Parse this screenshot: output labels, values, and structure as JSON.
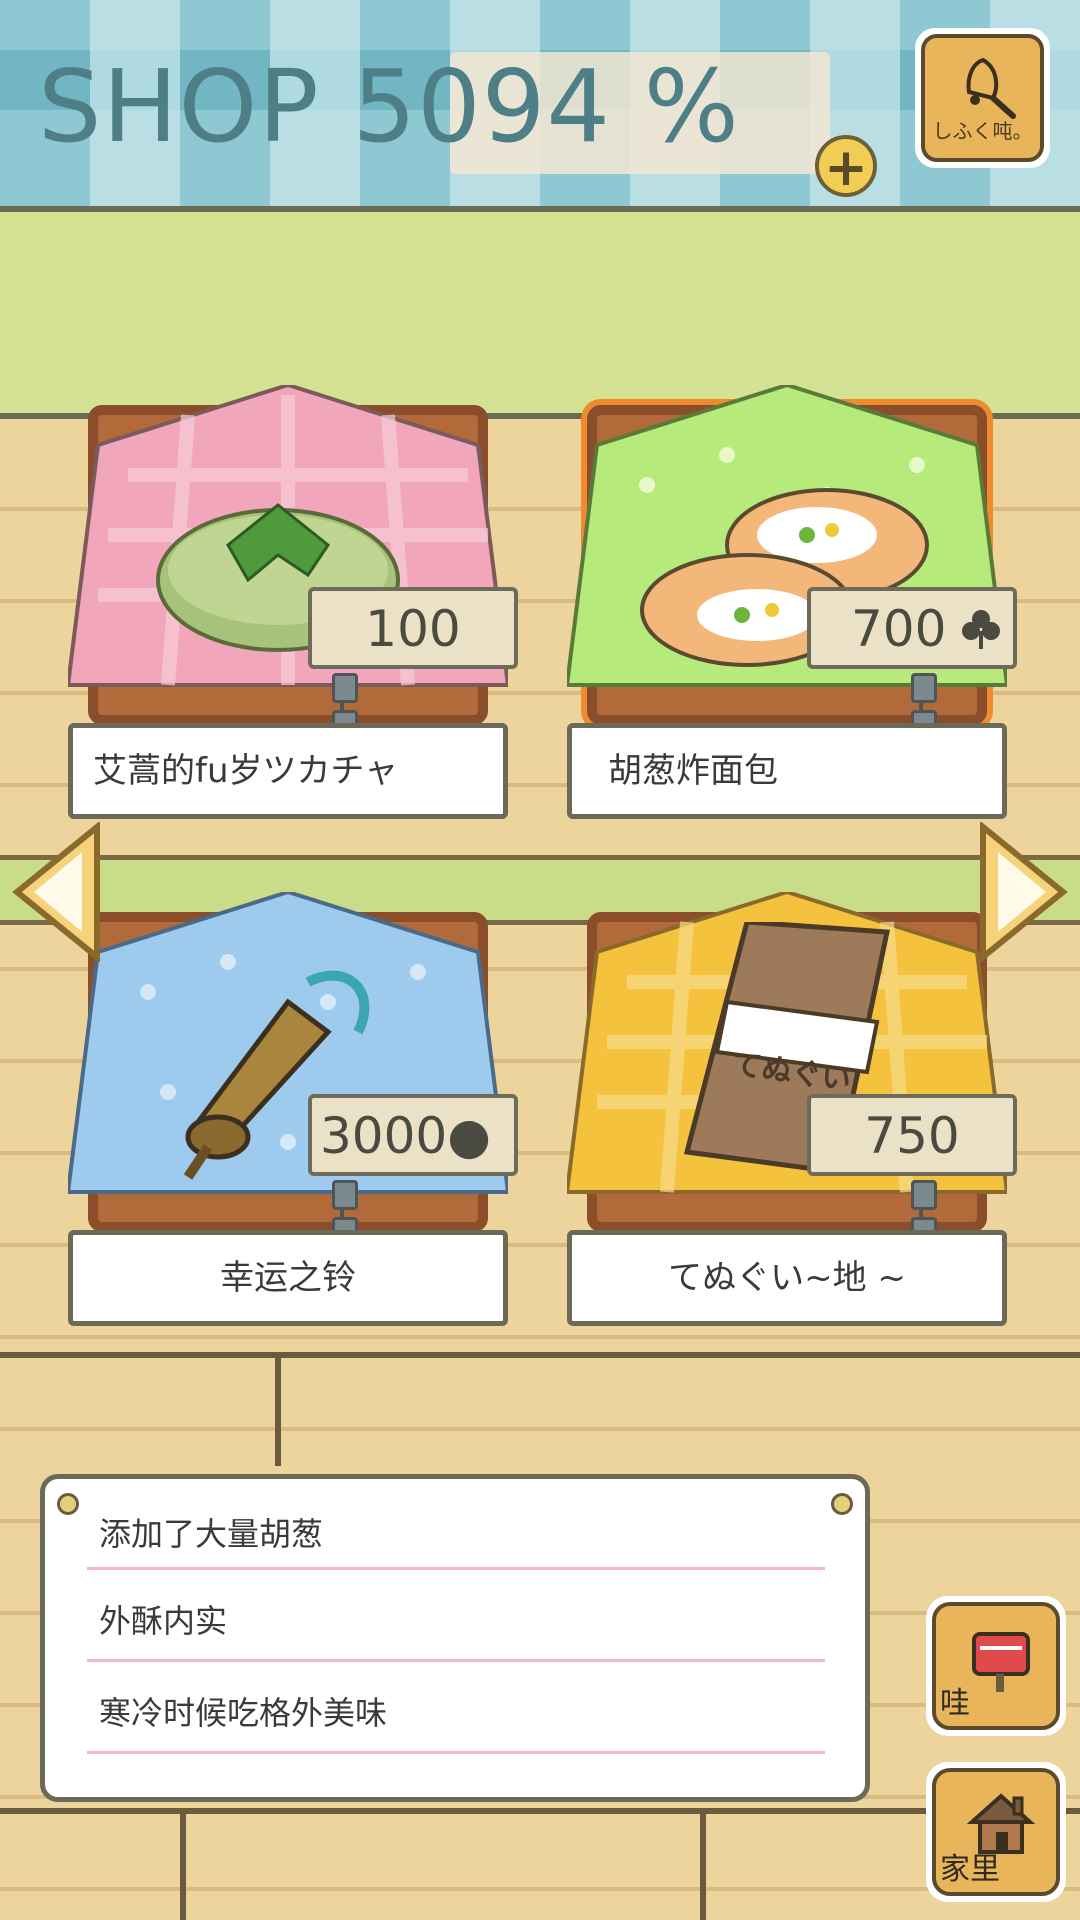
{
  "header": {
    "title": "SHOP 5094 %",
    "plus_symbol": "+",
    "bell_button_label": "しふく吨。"
  },
  "items": [
    {
      "name": "艾蒿的fu岁ツカチャ",
      "price": "100",
      "selected": false
    },
    {
      "name": "胡葱炸面包",
      "price": "700",
      "selected": true,
      "currency_icon": "clover-icon"
    },
    {
      "name": "幸运之铃",
      "price": "3000●",
      "selected": false
    },
    {
      "name": "てぬぐい~地    ~",
      "price": "750",
      "selected": false,
      "item_print": "てぬぐい"
    }
  ],
  "description": {
    "lines": [
      "添加了大量胡葱",
      "外酥内实",
      "寒冷时候吃格外美味"
    ]
  },
  "side_buttons": [
    {
      "label": "哇",
      "icon": "mailbox-icon"
    },
    {
      "label": "家里",
      "icon": "house-icon"
    }
  ],
  "navigation": {
    "prev_icon": "left-arrow-icon",
    "next_icon": "right-arrow-icon"
  },
  "colors": {
    "selected_outline": "#f08a2c",
    "header_teal": "#5aa7b6",
    "wood": "#ecd49c"
  }
}
